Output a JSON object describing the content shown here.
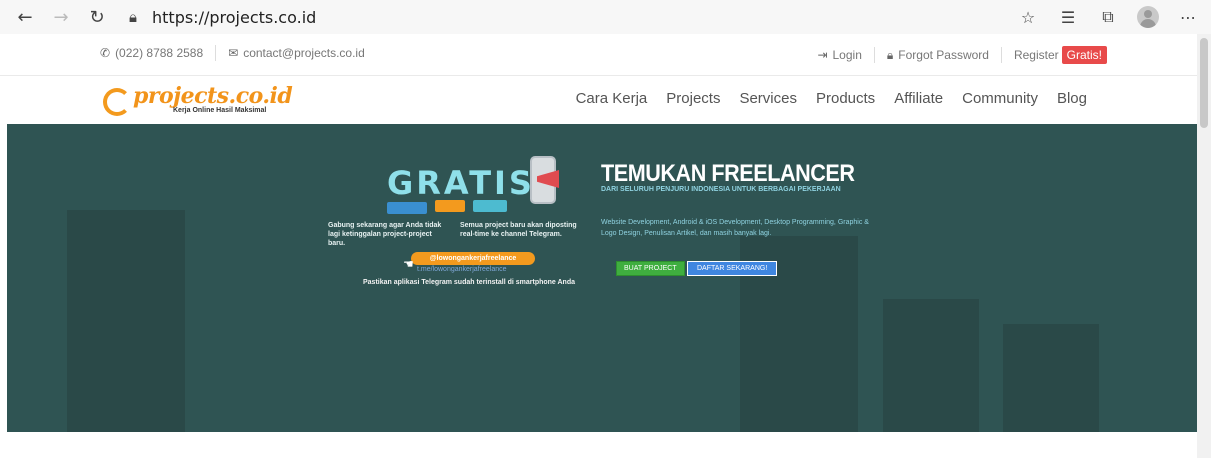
{
  "browser": {
    "url": "https://projects.co.id",
    "icons": {
      "back": "back-arrow-icon",
      "forward": "forward-arrow-icon",
      "refresh": "refresh-icon",
      "lock": "lock-icon",
      "favorite": "star-icon",
      "favorites_list": "favorites-list-icon",
      "collections": "collections-icon",
      "profile": "avatar",
      "more": "more-icon"
    }
  },
  "topbar": {
    "phone": "(022) 8788 2588",
    "email": "contact@projects.co.id",
    "login": "Login",
    "forgot_password": "Forgot Password",
    "register": "Register",
    "register_badge": "Gratis!"
  },
  "logo": {
    "name": "projects.co.id",
    "tagline": "Kerja Online Hasil Maksimal"
  },
  "menu": {
    "items": [
      "Cara Kerja",
      "Projects",
      "Services",
      "Products",
      "Affiliate",
      "Community",
      "Blog"
    ]
  },
  "hero": {
    "promo": {
      "headline": "GRATIS",
      "caption_left": "Gabung sekarang agar Anda tidak lagi ketinggalan project-project baru.",
      "caption_right": "Semua project baru akan diposting real-time ke channel Telegram.",
      "telegram_handle": "@lowongankerjafreelance",
      "telegram_link": "t.me/lowongankerjafreelance",
      "note": "Pastikan aplikasi Telegram sudah terinstall di smartphone Anda"
    },
    "title": "TEMUKAN FREELANCER",
    "subtitle": "DARI SELURUH PENJURU INDONESIA UNTUK BERBAGAI PEKERJAAN",
    "description": "Website Development, Android & iOS Development, Desktop Programming, Graphic & Logo Design, Penulisan Artikel, dan masih banyak lagi.",
    "btn_buat": "BUAT PROJECT",
    "btn_daftar": "DAFTAR SEKARANG!"
  },
  "colors": {
    "hero_bg": "#2f5453",
    "accent_orange": "#f2941b",
    "badge_red": "#e84a4a",
    "btn_green": "#3fae3f",
    "btn_blue": "#3f86e0"
  }
}
